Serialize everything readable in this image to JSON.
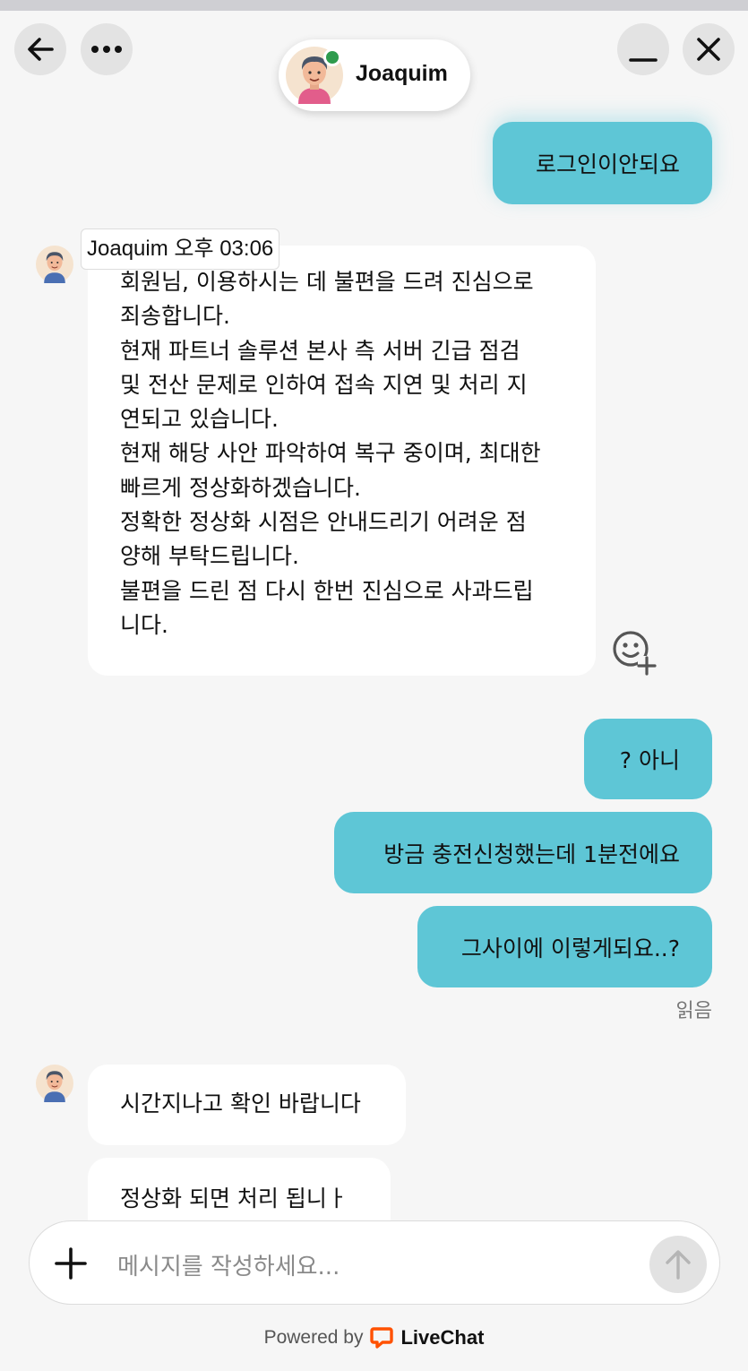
{
  "header": {
    "agent_name": "Joaquim",
    "icons": [
      "back-arrow-icon",
      "more-icon",
      "minimize-icon",
      "close-icon"
    ],
    "online_status_color": "#2e9b4d"
  },
  "messages": {
    "m1": "로그인이안되요",
    "agent_meta": "Joaquim 오후 03:06",
    "long_lines": [
      "회원님, 이용하시는 데 불편을 드려 진심으로",
      "죄송합니다.",
      "현재 파트너 솔루션 본사 측 서버 긴급 점검",
      "및 전산 문제로 인하여 접속 지연 및 처리 지",
      "연되고 있습니다.",
      "현재 해당 사안 파악하여 복구 중이며, 최대한",
      "빠르게 정상화하겠습니다.",
      "정확한 정상화 시점은 안내드리기 어려운 점",
      "양해 부탁드립니다.",
      "불편을 드린 점 다시 한번 진심으로 사과드립",
      "니다."
    ],
    "m3": "? 아니",
    "m4": "방금 충전신청했는데 1분전에요",
    "m5": "그사이에 이렇게되요..?",
    "read_status": "읽음",
    "m6": "시간지나고 확인 바랍니다",
    "m7": "정상화 되면 처리 됩니ㅏ"
  },
  "composer": {
    "placeholder": "메시지를 작성하세요..."
  },
  "footer": {
    "powered_by": "Powered by",
    "brand": "LiveChat"
  },
  "colors": {
    "outgoing_bubble": "#5ec6d6",
    "incoming_bubble": "#ffffff",
    "background": "#f6f6f6",
    "brand_orange": "#ff5100"
  }
}
